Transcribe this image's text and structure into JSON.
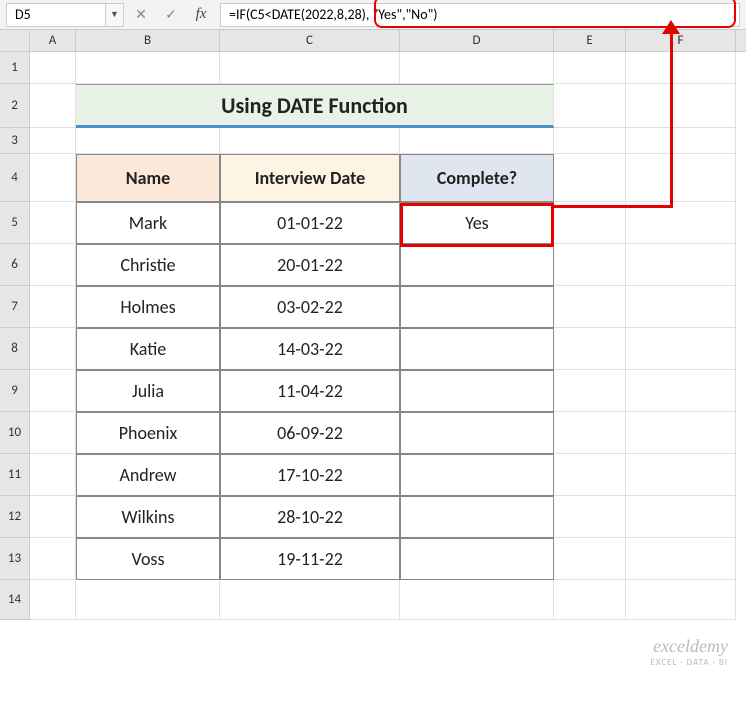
{
  "name_box": "D5",
  "formula": "=IF(C5<DATE(2022,8,28), \"Yes\",\"No\")",
  "columns": [
    "A",
    "B",
    "C",
    "D",
    "E",
    "F"
  ],
  "rows": [
    "1",
    "2",
    "3",
    "4",
    "5",
    "6",
    "7",
    "8",
    "9",
    "10",
    "11",
    "12",
    "13",
    "14"
  ],
  "title": "Using DATE Function",
  "headers": {
    "name": "Name",
    "date": "Interview Date",
    "complete": "Complete?"
  },
  "data": [
    {
      "name": "Mark",
      "date": "01-01-22",
      "complete": "Yes"
    },
    {
      "name": "Christie",
      "date": "20-01-22",
      "complete": ""
    },
    {
      "name": "Holmes",
      "date": "03-02-22",
      "complete": ""
    },
    {
      "name": "Katie",
      "date": "14-03-22",
      "complete": ""
    },
    {
      "name": "Julia",
      "date": "11-04-22",
      "complete": ""
    },
    {
      "name": "Phoenix",
      "date": "06-09-22",
      "complete": ""
    },
    {
      "name": "Andrew",
      "date": "17-10-22",
      "complete": ""
    },
    {
      "name": "Wilkins",
      "date": "28-10-22",
      "complete": ""
    },
    {
      "name": "Voss",
      "date": "19-11-22",
      "complete": ""
    }
  ],
  "watermark": {
    "line1": "exceldemy",
    "line2": "EXCEL · DATA · BI"
  },
  "icons": {
    "dropdown": "▼",
    "cancel": "✕",
    "enter": "✓",
    "fx": "fx"
  }
}
